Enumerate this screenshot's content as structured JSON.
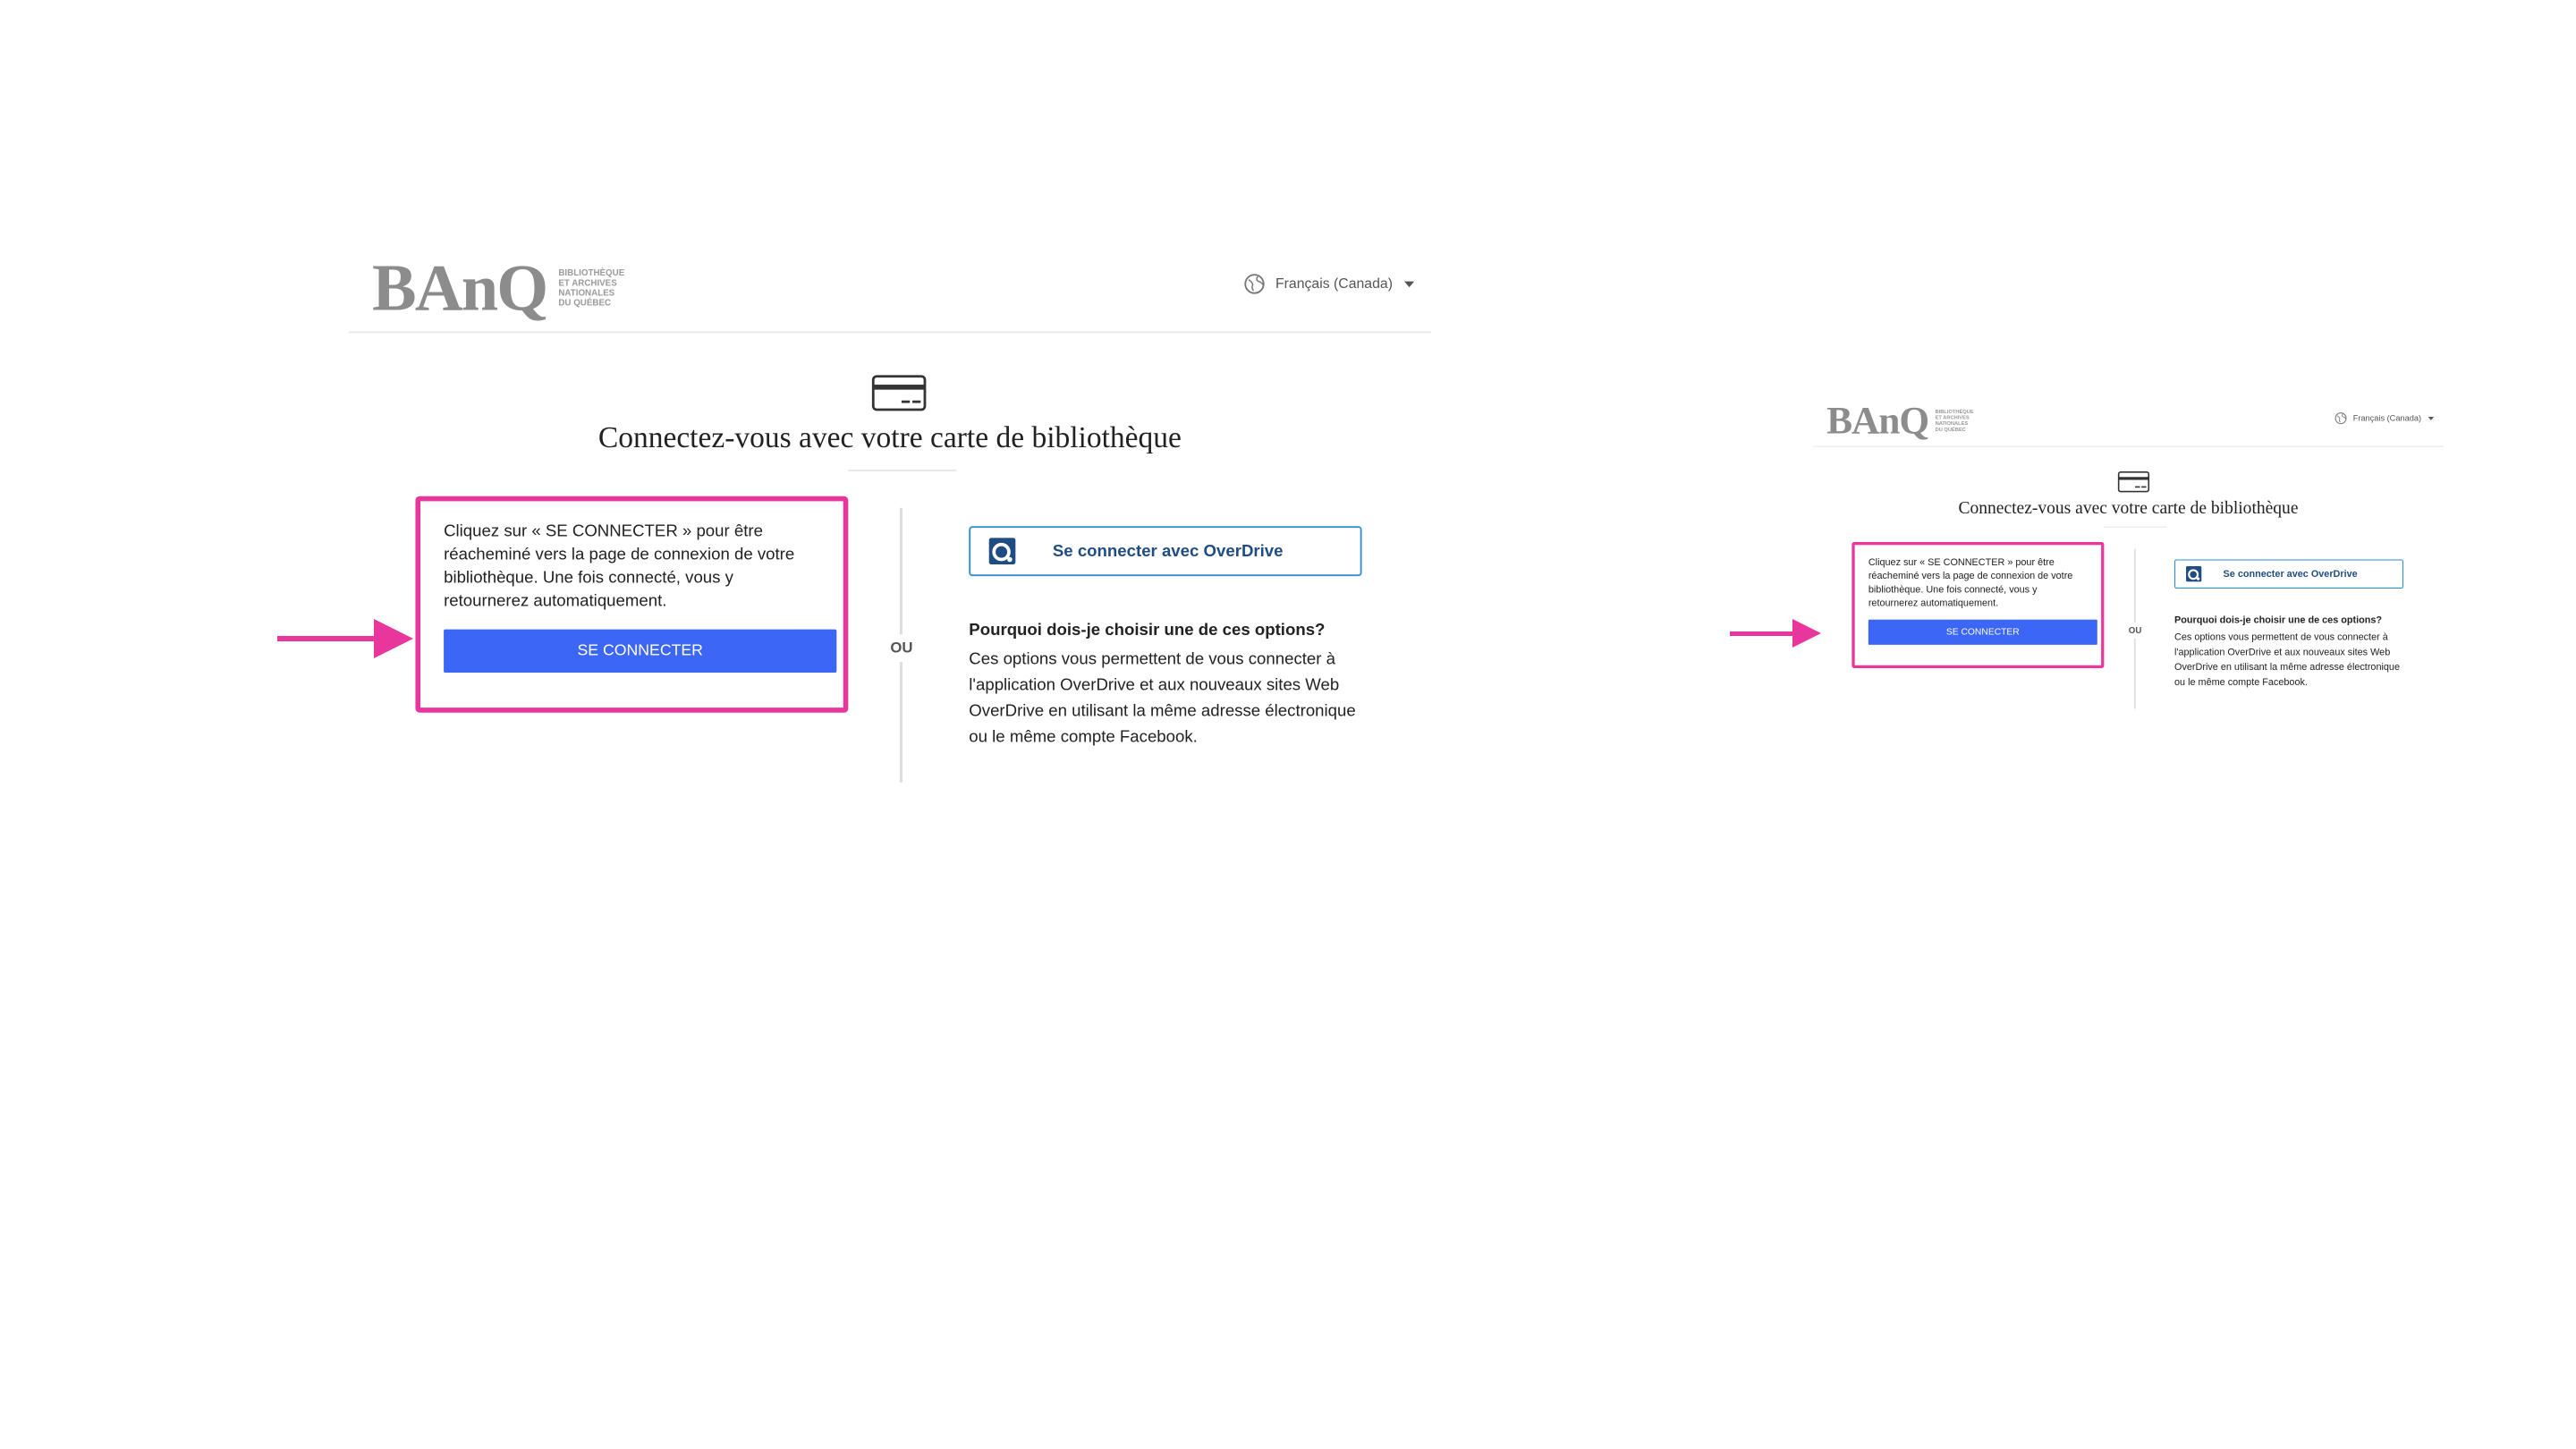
{
  "brand": {
    "mark": "BAnQ",
    "subtitle": [
      "BIBLIOTHÈQUE",
      "ET ARCHIVES",
      "NATIONALES",
      "DU QUÉBEC"
    ]
  },
  "header": {
    "language": "Français (Canada)"
  },
  "main": {
    "title": "Connectez-vous avec votre carte de bibliothèque",
    "login_text": "Cliquez sur « SE CONNECTER » pour être réacheminé vers la page de connexion de votre bibliothèque. Une fois connecté, vous y retournerez automatiquement.",
    "login_button": "SE CONNECTER",
    "or_label": "OU",
    "overdrive_button": "Se connecter avec OverDrive",
    "why_title": "Pourquoi dois-je choisir une de ces options?",
    "why_text": "Ces options vous permettent de vous connecter à l'application OverDrive et aux nouveaux sites Web OverDrive en utilisant la même adresse électronique ou le même compte Facebook."
  },
  "icons": {
    "card": "library-card-icon",
    "globe": "globe-icon",
    "caret": "chevron-down-icon",
    "overdrive": "overdrive-logo-icon",
    "arrow": "arrow-right-icon"
  },
  "colors": {
    "highlight": "#e8369c",
    "primary_button": "#3c66f5",
    "overdrive_border": "#2e8fd6",
    "overdrive_text": "#1f4c83",
    "logo_gray": "#8c8c8c"
  }
}
